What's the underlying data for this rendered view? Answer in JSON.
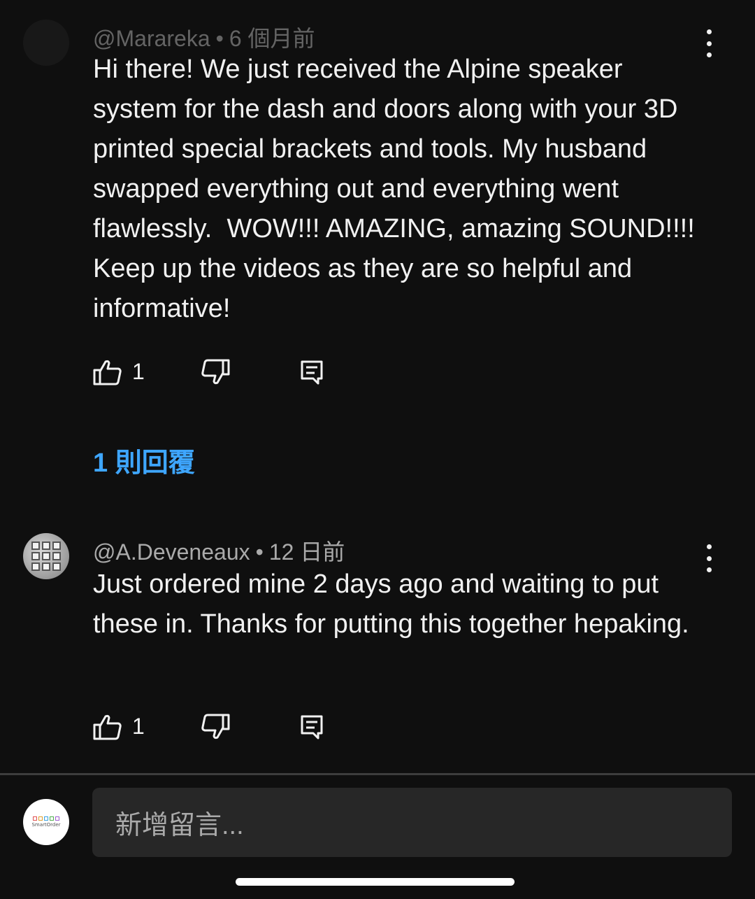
{
  "comments": [
    {
      "author": "@Marareka",
      "time": "6 個月前",
      "text": "Hi there! We just received the Alpine speaker system for the dash and doors along with your 3D printed special brackets and tools. My husband swapped everything out and everything went flawlessly.  WOW!!! AMAZING, amazing SOUND!!!! Keep up the videos as they are so helpful and informative!",
      "likes": "1",
      "replies_label": "1 則回覆"
    },
    {
      "author": "@A.Deveneaux",
      "time": "12 日前",
      "text": "Just ordered mine 2 days ago and waiting to put these in. Thanks for putting this together hepaking.",
      "likes": "1"
    }
  ],
  "composer": {
    "placeholder": "新增留言...",
    "avatar_text": "SmartOrder"
  },
  "icons": {
    "like": "thumb-up-icon",
    "dislike": "thumb-down-icon",
    "reply": "reply-comment-icon",
    "more": "more-vert-icon"
  },
  "colors": {
    "background": "#0f0f0f",
    "text": "#f1f1f1",
    "secondary_text": "#aaaaaa",
    "link": "#3ea6ff",
    "input_bg": "#272727"
  }
}
